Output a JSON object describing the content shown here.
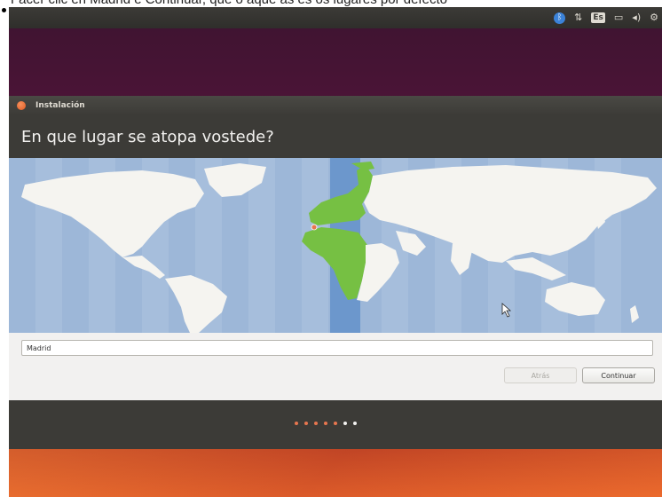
{
  "caption": {
    "text": "Facer clic en Madrid e Continuar, que o aque as es os lugares por defecto"
  },
  "topbar": {
    "tray_icons": [
      "bluetooth-icon",
      "network-icon",
      "keyboard-layout-icon",
      "battery-icon",
      "volume-icon",
      "power-icon"
    ],
    "keyboard_label": "Es"
  },
  "window": {
    "title": "Instalación",
    "heading": "En que lugar se atopa vostede?"
  },
  "map": {
    "selected_zone_color": "#5c8cc8",
    "highlighted_country_color": "#76c043",
    "ocean_color": "#9db7d8",
    "land_color": "#f5f4f0"
  },
  "location": {
    "value": "Madrid"
  },
  "buttons": {
    "back": "Atrás",
    "continue": "Continuar"
  },
  "progress": {
    "current_step": 5,
    "total_steps": 7
  },
  "colors": {
    "accent": "#e7764f",
    "window_bg": "#3c3b37"
  }
}
